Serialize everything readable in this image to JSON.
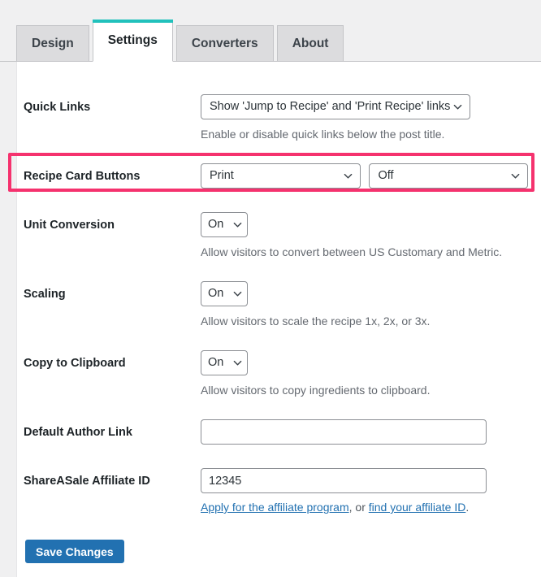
{
  "tabs": [
    {
      "label": "Design",
      "active": false
    },
    {
      "label": "Settings",
      "active": true
    },
    {
      "label": "Converters",
      "active": false
    },
    {
      "label": "About",
      "active": false
    }
  ],
  "colors": {
    "active_tab_accent": "#21c1bc",
    "highlight_border": "#f5326e",
    "primary_button": "#2271b1",
    "link": "#2271b1",
    "page_background": "#f0f0f1",
    "panel_background": "#ffffff"
  },
  "settings": {
    "quick_links": {
      "label": "Quick Links",
      "value": "Show 'Jump to Recipe' and 'Print Recipe' links",
      "help": "Enable or disable quick links below the post title."
    },
    "recipe_card_buttons": {
      "label": "Recipe Card Buttons",
      "value_primary": "Print",
      "value_secondary": "Off",
      "highlighted": true
    },
    "unit_conversion": {
      "label": "Unit Conversion",
      "value": "On",
      "help": "Allow visitors to convert between US Customary and Metric."
    },
    "scaling": {
      "label": "Scaling",
      "value": "On",
      "help": "Allow visitors to scale the recipe 1x, 2x, or 3x."
    },
    "copy_to_clipboard": {
      "label": "Copy to Clipboard",
      "value": "On",
      "help": "Allow visitors to copy ingredients to clipboard."
    },
    "default_author_link": {
      "label": "Default Author Link",
      "value": "",
      "placeholder": ""
    },
    "shareasale_affiliate_id": {
      "label": "ShareASale Affiliate ID",
      "value": "12345",
      "placeholder": "",
      "note_link_1": "Apply for the affiliate program",
      "note_middle": ", or ",
      "note_link_2": "find your affiliate ID",
      "note_end": "."
    }
  },
  "actions": {
    "save_label": "Save Changes"
  }
}
